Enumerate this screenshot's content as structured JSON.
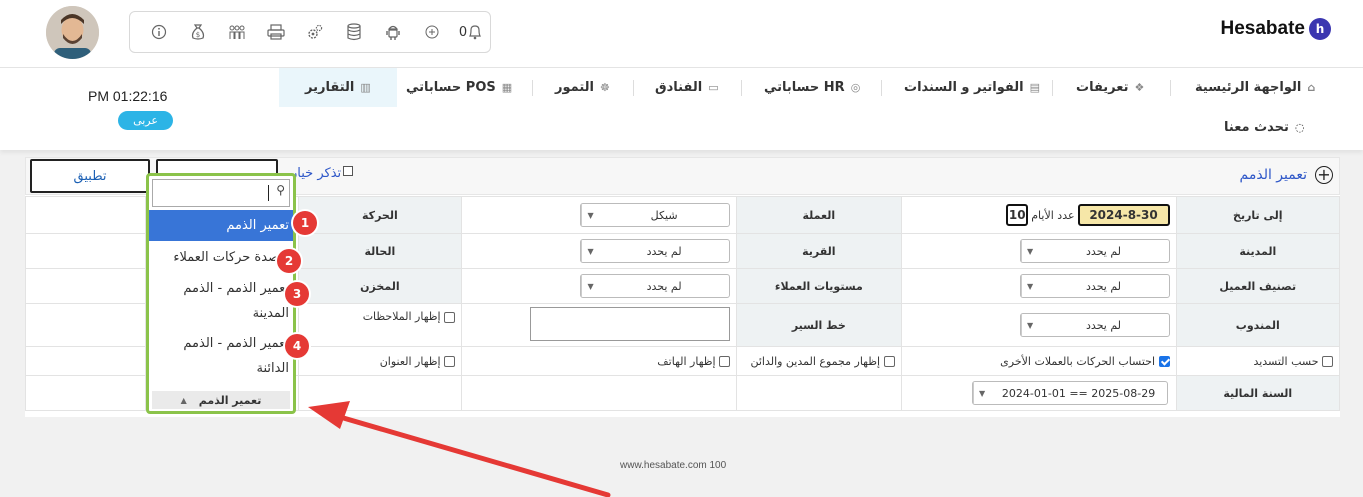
{
  "header": {
    "logo_text": "Hesabate",
    "logo_mark": "h",
    "toolbar_icons": [
      "info-icon",
      "money-bag-icon",
      "users-icon",
      "printer-icon",
      "settings-gears-icon",
      "database-icon",
      "android-icon",
      "plus-circle-icon",
      "bell-icon"
    ],
    "bell_count": "0"
  },
  "nav": {
    "time": "PM 01:22:16",
    "language_badge": "عربى",
    "items": [
      {
        "label": "الواجهة الرئيسية",
        "icon": "home-icon"
      },
      {
        "label": "تعريفات",
        "icon": "layers-icon"
      },
      {
        "label": "الفواتير و السندات",
        "icon": "invoice-icon"
      },
      {
        "label": "حساباتي HR",
        "icon": "hr-icon"
      },
      {
        "label": "الفنادق",
        "icon": "hotel-icon"
      },
      {
        "label": "التمور",
        "icon": "dates-icon"
      },
      {
        "label": "حساباتي POS",
        "icon": "pos-icon"
      },
      {
        "label": "التقارير",
        "icon": "reports-icon"
      }
    ],
    "contact": {
      "label": "تحدث معنا",
      "icon": "chat-icon"
    }
  },
  "panel": {
    "title": "تعمير الذمم",
    "apply_label": "تطبيق",
    "remember_label": "تذكر خيار"
  },
  "form": {
    "to_date_label": "إلى تاريخ",
    "to_date_value": "2024-8-30",
    "days_label": "عدد الأيام",
    "days_value": "10",
    "currency_label": "العملة",
    "currency_value": "شيكل",
    "movement_label": "الحركة",
    "city_label": "المدينة",
    "city_value": "لم يحدد",
    "village_label": "القرية",
    "village_value": "لم يحدد",
    "status_label": "الحالة",
    "status_value": "لم يحدد",
    "customer_class_label": "تصنيف العميل",
    "customer_class_value": "لم يحدد",
    "customer_levels_label": "مستويات العملاء",
    "customer_levels_value": "لم يحدد",
    "warehouse_label": "المخزن",
    "warehouse_value": "لم يحدد",
    "rep_label": "المندوب",
    "rep_value": "لم يحدد",
    "route_label": "خط السير",
    "show_notes_label": "إظهار الملاحظات",
    "by_payment_label": "حسب التسديد",
    "other_currencies_label": "احتساب الحركات بالعملات الأخرى",
    "debtor_creditor_label": "إظهار مجموع المدين والدائن",
    "show_phone_label": "إظهار الهاتف",
    "show_address_label": "إظهار العنوان",
    "fiscal_year_label": "السنة المالية",
    "fiscal_year_value": "2024-01-01 == 2025-08-29"
  },
  "dropdown": {
    "options": [
      "تعمير الذمم",
      "أرصدة حركات العملاء",
      "تعمير الذمم - الذمم المدينة",
      "تعمير الذمم - الذمم الدائنة"
    ],
    "selected": "تعمير الذمم",
    "badges": [
      "1",
      "2",
      "3",
      "4"
    ]
  },
  "footer": {
    "text": "www.hesabate.com 100"
  },
  "colors": {
    "accent": "#2e57c8",
    "highlight": "#3875d7",
    "popup_border": "#8bc34a",
    "badge": "#e53935",
    "arrow": "#e53935"
  }
}
